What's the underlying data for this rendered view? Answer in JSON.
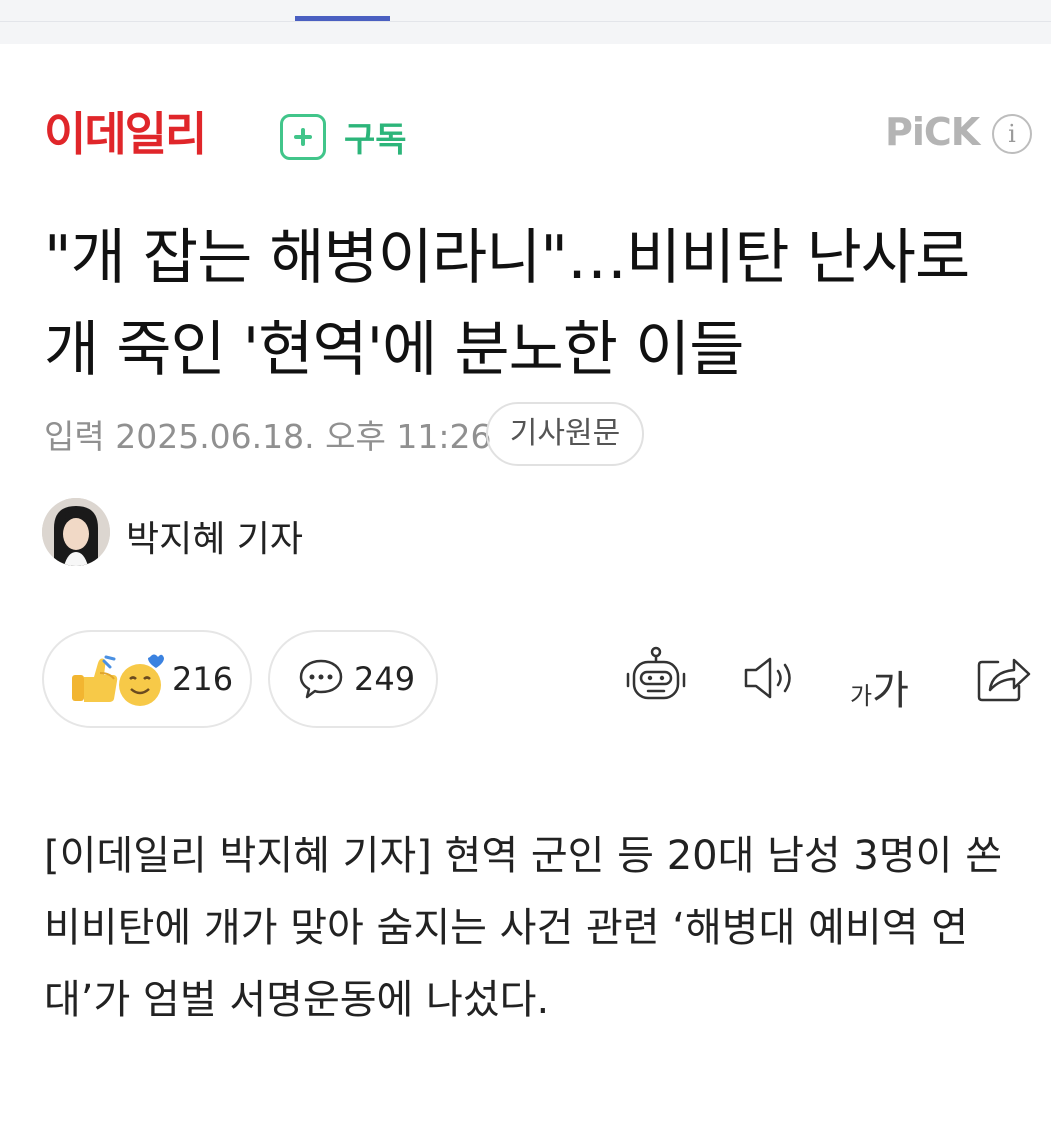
{
  "press": {
    "name": "이데일리",
    "subscribe_label": "구독"
  },
  "pick": {
    "label": "PiCK",
    "info_symbol": "i"
  },
  "article": {
    "headline": "\"개 잡는 해병이라니\"…비비탄 난사로 개 죽인 '현역'에 분노한 이들",
    "input_date": "입력 2025.06.18. 오후 11:26",
    "original_button": "기사원문",
    "reporter": "박지혜 기자",
    "body": "[이데일리 박지혜 기자] 현역 군인 등 20대 남성 3명이 쏜 비비탄에 개가 맞아 숨지는 사건 관련 ‘해병대 예비역 연대’가 엄벌 서명운동에 나섰다."
  },
  "reactions": {
    "count": "216"
  },
  "comments": {
    "count": "249"
  },
  "toolbar": {
    "font_size_small": "가",
    "font_size_large": "가",
    "icons": [
      "ai-summary-robot-icon",
      "tts-speaker-icon",
      "font-size-icon",
      "share-icon"
    ]
  },
  "colors": {
    "press_red": "#e0262a",
    "subscribe_green": "#41c58a",
    "tab_indicator": "#4a5fc1"
  }
}
